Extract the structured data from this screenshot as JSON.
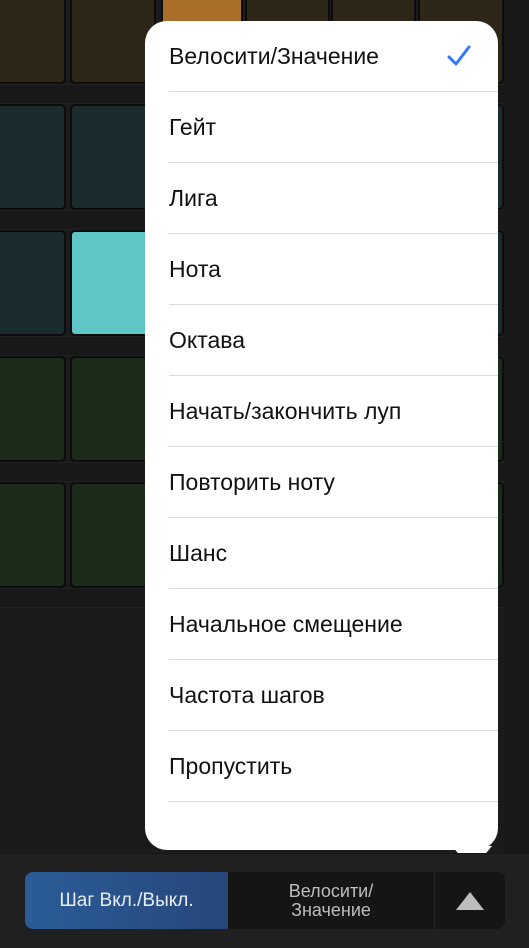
{
  "grid": {
    "rows": [
      {
        "color": "#2e2616",
        "pads": [
          {
            "active": false
          },
          {
            "active": false
          },
          {
            "active": true,
            "color": "#a86e2a"
          },
          {
            "active": false
          },
          {
            "active": false
          },
          {
            "active": false
          }
        ]
      },
      {
        "color": "#1b2c2f",
        "pads": [
          {
            "active": false
          },
          {
            "active": false
          },
          {
            "active": false
          },
          {
            "active": false
          },
          {
            "active": false
          },
          {
            "active": false
          }
        ]
      },
      {
        "color": "#1b2c31",
        "pads": [
          {
            "active": false
          },
          {
            "active": true,
            "color": "#5ec6c6"
          },
          {
            "active": false
          },
          {
            "active": false
          },
          {
            "active": false
          },
          {
            "active": false
          }
        ]
      },
      {
        "color": "#1b2b1a",
        "pads": [
          {
            "active": false
          },
          {
            "active": false
          },
          {
            "active": false
          },
          {
            "active": false
          },
          {
            "active": false
          },
          {
            "active": false
          }
        ]
      },
      {
        "color": "#1b2b1a",
        "pads": [
          {
            "active": false
          },
          {
            "active": false
          },
          {
            "active": false
          },
          {
            "active": false
          },
          {
            "active": false
          },
          {
            "active": false
          }
        ]
      }
    ]
  },
  "menu": {
    "selected_index": 0,
    "check_color": "#3478f6",
    "items": [
      {
        "label": "Велосити/Значение",
        "checked": true,
        "icon": "checkmark-icon"
      },
      {
        "label": "Гейт",
        "checked": false
      },
      {
        "label": "Лига",
        "checked": false
      },
      {
        "label": "Нота",
        "checked": false
      },
      {
        "label": "Октава",
        "checked": false
      },
      {
        "label": "Начать/закончить луп",
        "checked": false
      },
      {
        "label": "Повторить ноту",
        "checked": false
      },
      {
        "label": "Шанс",
        "checked": false
      },
      {
        "label": "Начальное смещение",
        "checked": false
      },
      {
        "label": "Частота шагов",
        "checked": false
      },
      {
        "label": "Пропустить",
        "checked": false
      }
    ]
  },
  "toolbar": {
    "step_toggle_label": "Шаг Вкл./Выкл.",
    "step_toggle_active": true,
    "velocity_label_line1": "Велосити/",
    "velocity_label_line2": "Значение",
    "expand_icon": "triangle-up-icon",
    "accent_color": "#2b5c98"
  }
}
